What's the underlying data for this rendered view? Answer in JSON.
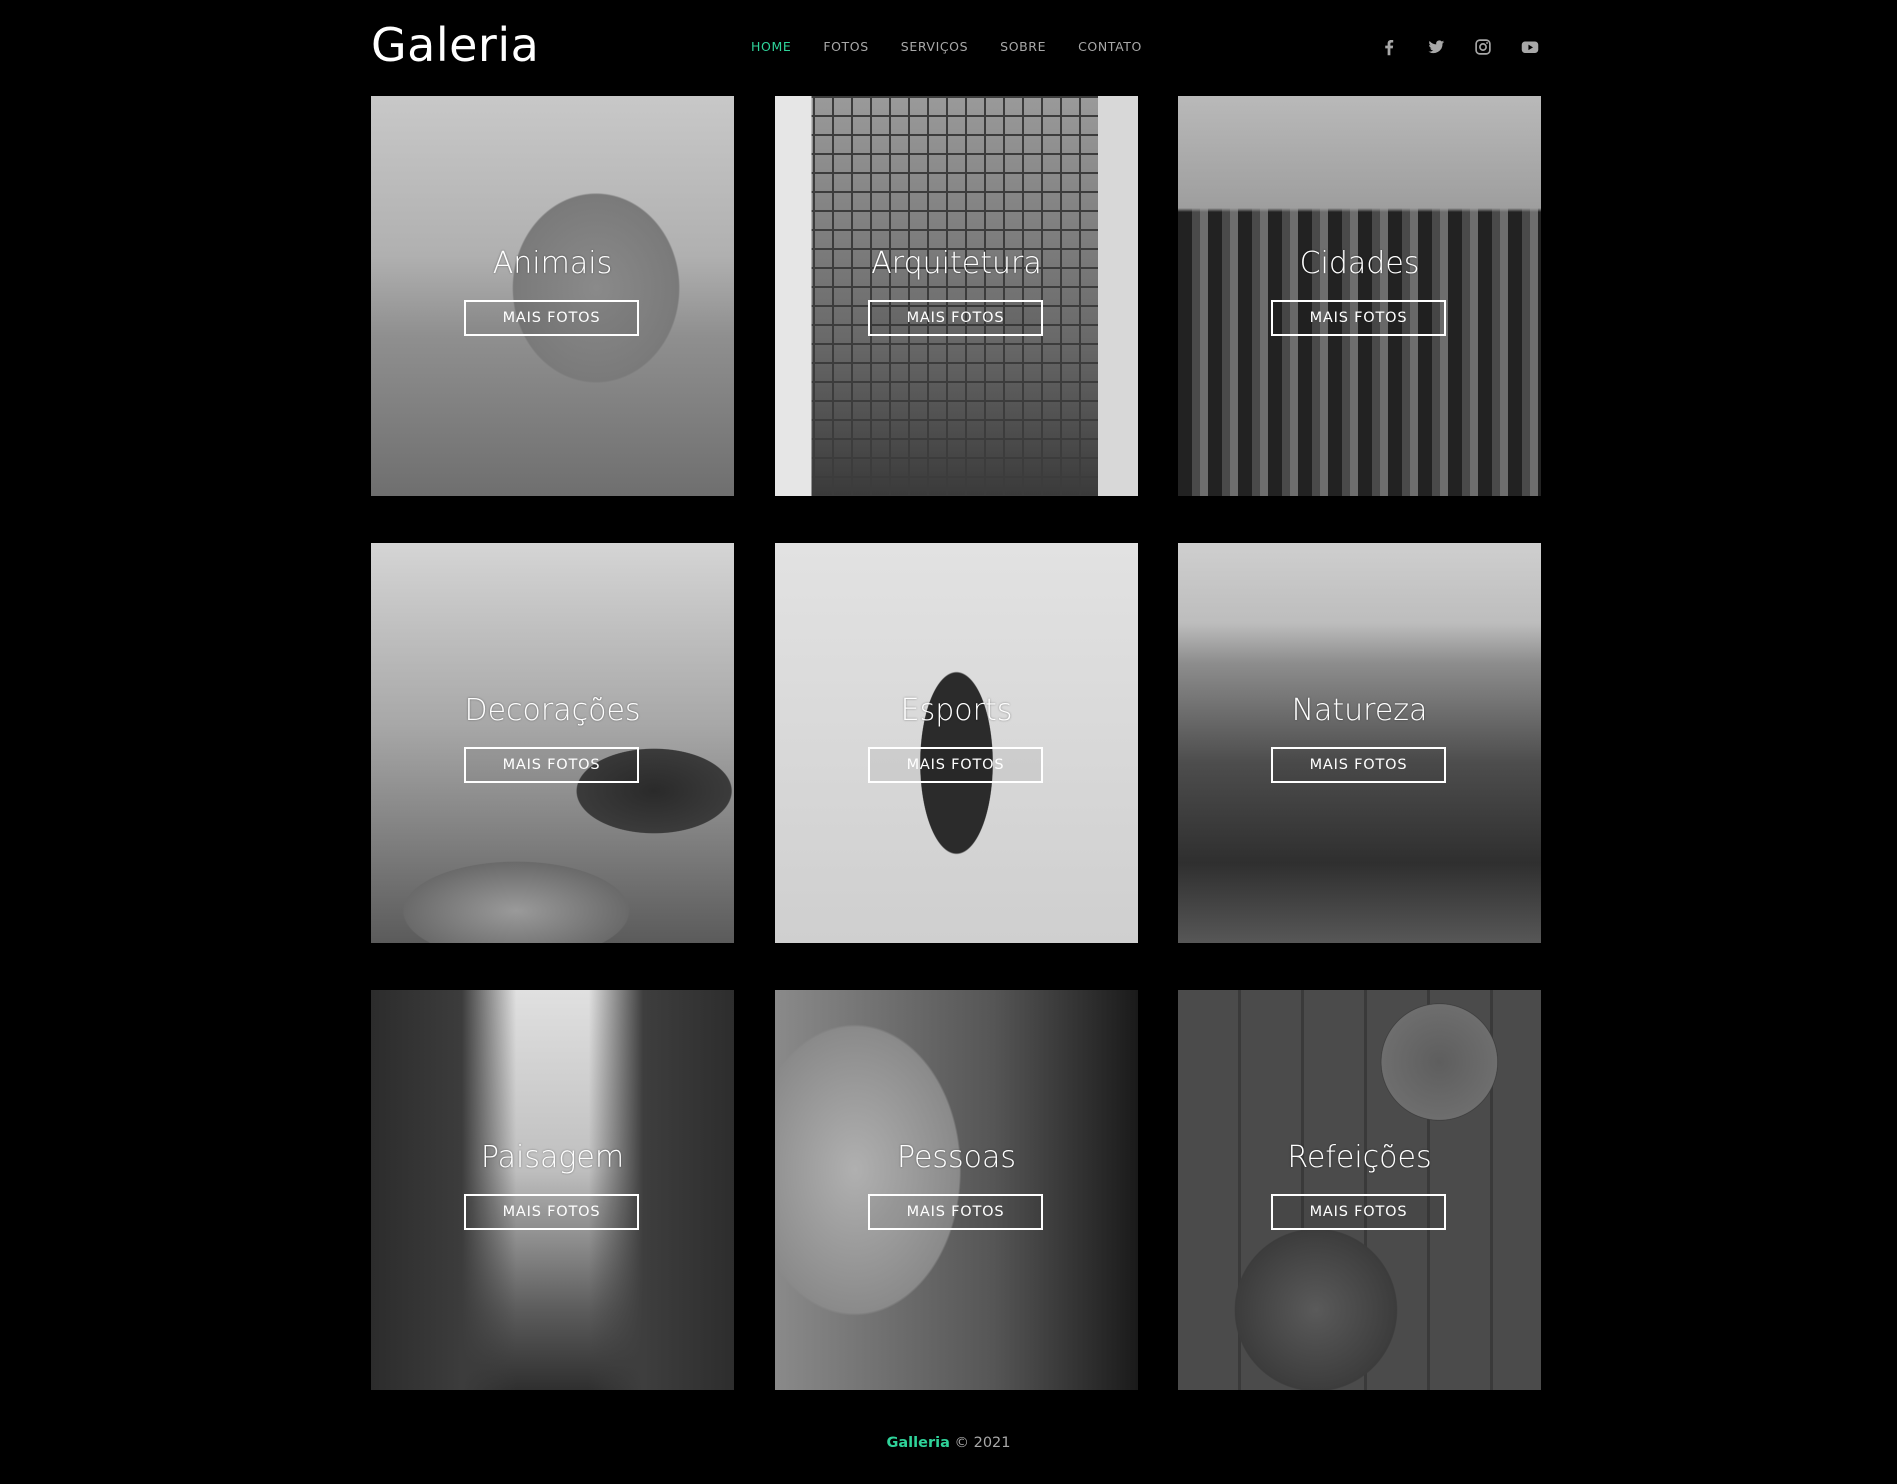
{
  "header": {
    "logo": "Galeria",
    "nav": [
      {
        "label": "HOME",
        "active": true
      },
      {
        "label": "FOTOS",
        "active": false
      },
      {
        "label": "SERVIÇOS",
        "active": false
      },
      {
        "label": "SOBRE",
        "active": false
      },
      {
        "label": "CONTATO",
        "active": false
      }
    ],
    "social_icons": [
      "facebook-icon",
      "twitter-icon",
      "instagram-icon",
      "youtube-icon"
    ]
  },
  "gallery": {
    "button_label": "MAIS FOTOS",
    "tiles": [
      {
        "title": "Animais"
      },
      {
        "title": "Arquitetura"
      },
      {
        "title": "Cidades"
      },
      {
        "title": "Decorações"
      },
      {
        "title": "Esports"
      },
      {
        "title": "Natureza"
      },
      {
        "title": "Paisagem"
      },
      {
        "title": "Pessoas"
      },
      {
        "title": "Refeições"
      }
    ]
  },
  "footer": {
    "brand": "Galleria",
    "copyright": "© 2021"
  },
  "colors": {
    "accent": "#2fd39a",
    "background": "#000000",
    "nav_text": "#a8a8a8"
  }
}
